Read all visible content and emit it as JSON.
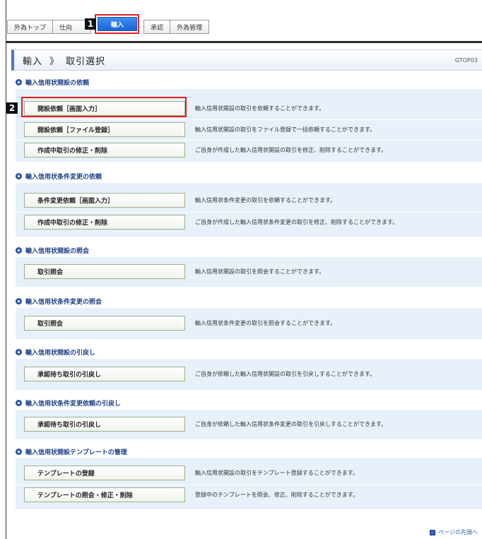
{
  "tabs": {
    "t0": "外為トップ",
    "t1": "仕向",
    "t2": "輸入",
    "t3": "承認",
    "t4": "外為管理"
  },
  "badges": {
    "b1": "1",
    "b2": "2"
  },
  "title": {
    "section": "輸入",
    "separator": "》",
    "page": "取引選択",
    "code": "GTOP03"
  },
  "sections": [
    {
      "heading": "輸入信用状開設の依頼",
      "rows": [
        {
          "button": "開設依頼［画面入力］",
          "desc": "輸入信用状開設の取引を依頼することができます。"
        },
        {
          "button": "開設依頼［ファイル登録］",
          "desc": "輸入信用状開設の取引をファイル登録で一括依頼することができます。"
        },
        {
          "button": "作成中取引の修正・削除",
          "desc": "ご自身が作成した輸入信用状開設の取引を修正、削除することができます。"
        }
      ]
    },
    {
      "heading": "輸入信用状条件変更の依頼",
      "rows": [
        {
          "button": "条件変更依頼［画面入力］",
          "desc": "輸入信用状条件変更の取引を依頼することができます。"
        },
        {
          "button": "作成中取引の修正・削除",
          "desc": "ご自身が作成した輸入信用状条件変更の取引を修正、削除することができます。"
        }
      ]
    },
    {
      "heading": "輸入信用状開設の照会",
      "rows": [
        {
          "button": "取引照会",
          "desc": "輸入信用状開設の取引を照会することができます。"
        }
      ]
    },
    {
      "heading": "輸入信用状条件変更の照会",
      "rows": [
        {
          "button": "取引照会",
          "desc": "輸入信用状条件変更の取引を照会することができます。"
        }
      ]
    },
    {
      "heading": "輸入信用状開設の引戻し",
      "rows": [
        {
          "button": "承認待ち取引の引戻し",
          "desc": "ご自身が依頼した輸入信用状開設の取引を引戻しすることができます。"
        }
      ]
    },
    {
      "heading": "輸入信用状条件変更依頼の引戻し",
      "rows": [
        {
          "button": "承認待ち取引の引戻し",
          "desc": "ご自身が依頼した輸入信用状条件変更の取引を引戻しすることができます。"
        }
      ]
    },
    {
      "heading": "輸入信用状開設テンプレートの管理",
      "rows": [
        {
          "button": "テンプレートの登録",
          "desc": "輸入信用状開設の取引をテンプレート登録することができます。"
        },
        {
          "button": "テンプレートの照会・修正・削除",
          "desc": "登録中のテンプレートを照会、修正、削除することができます。"
        }
      ]
    }
  ],
  "footer": {
    "page_top": "ページの先頭へ"
  },
  "colors": {
    "accent": "#1b63d6",
    "highlight": "#e02020",
    "panel": "#e8f0fa",
    "heading": "#1c3f86"
  }
}
